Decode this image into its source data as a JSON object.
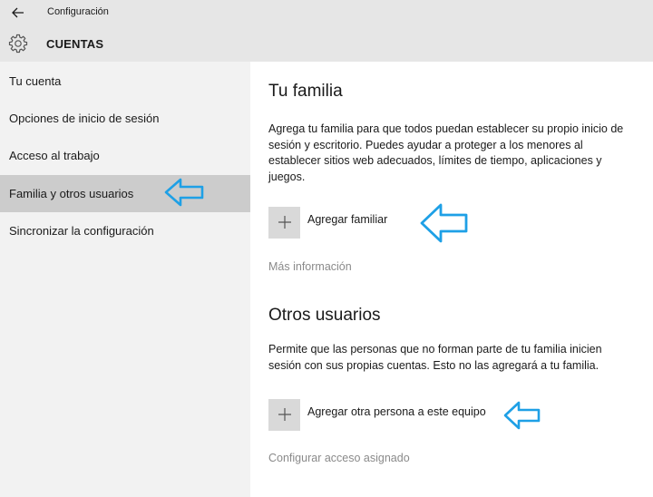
{
  "window": {
    "title": "Configuración",
    "back_icon": "back-arrow-icon"
  },
  "header": {
    "icon": "gear-icon",
    "title": "CUENTAS"
  },
  "sidebar": {
    "items": [
      {
        "label": "Tu cuenta",
        "selected": false
      },
      {
        "label": "Opciones de inicio de sesión",
        "selected": false
      },
      {
        "label": "Acceso al trabajo",
        "selected": false
      },
      {
        "label": "Familia y otros usuarios",
        "selected": true
      },
      {
        "label": "Sincronizar la configuración",
        "selected": false
      }
    ]
  },
  "main": {
    "family": {
      "heading": "Tu familia",
      "description": "Agrega tu familia para que todos puedan establecer su propio inicio de sesión y escritorio. Puedes ayudar a proteger a los menores al establecer sitios web adecuados, límites de tiempo, aplicaciones y juegos.",
      "add_label": "Agregar familiar",
      "link": "Más información"
    },
    "others": {
      "heading": "Otros usuarios",
      "description": "Permite que las personas que no forman parte de tu familia inicien sesión con sus propias cuentas. Esto no las agregará a tu familia.",
      "add_label": "Agregar otra persona a este equipo",
      "link": "Configurar acceso asignado"
    }
  },
  "colors": {
    "annotation_arrow": "#1ea0e6",
    "selected_bg": "#cccccc",
    "sidebar_bg": "#f2f2f2",
    "titlebar_bg": "#e6e6e6",
    "link_text": "#8a8a8a"
  }
}
